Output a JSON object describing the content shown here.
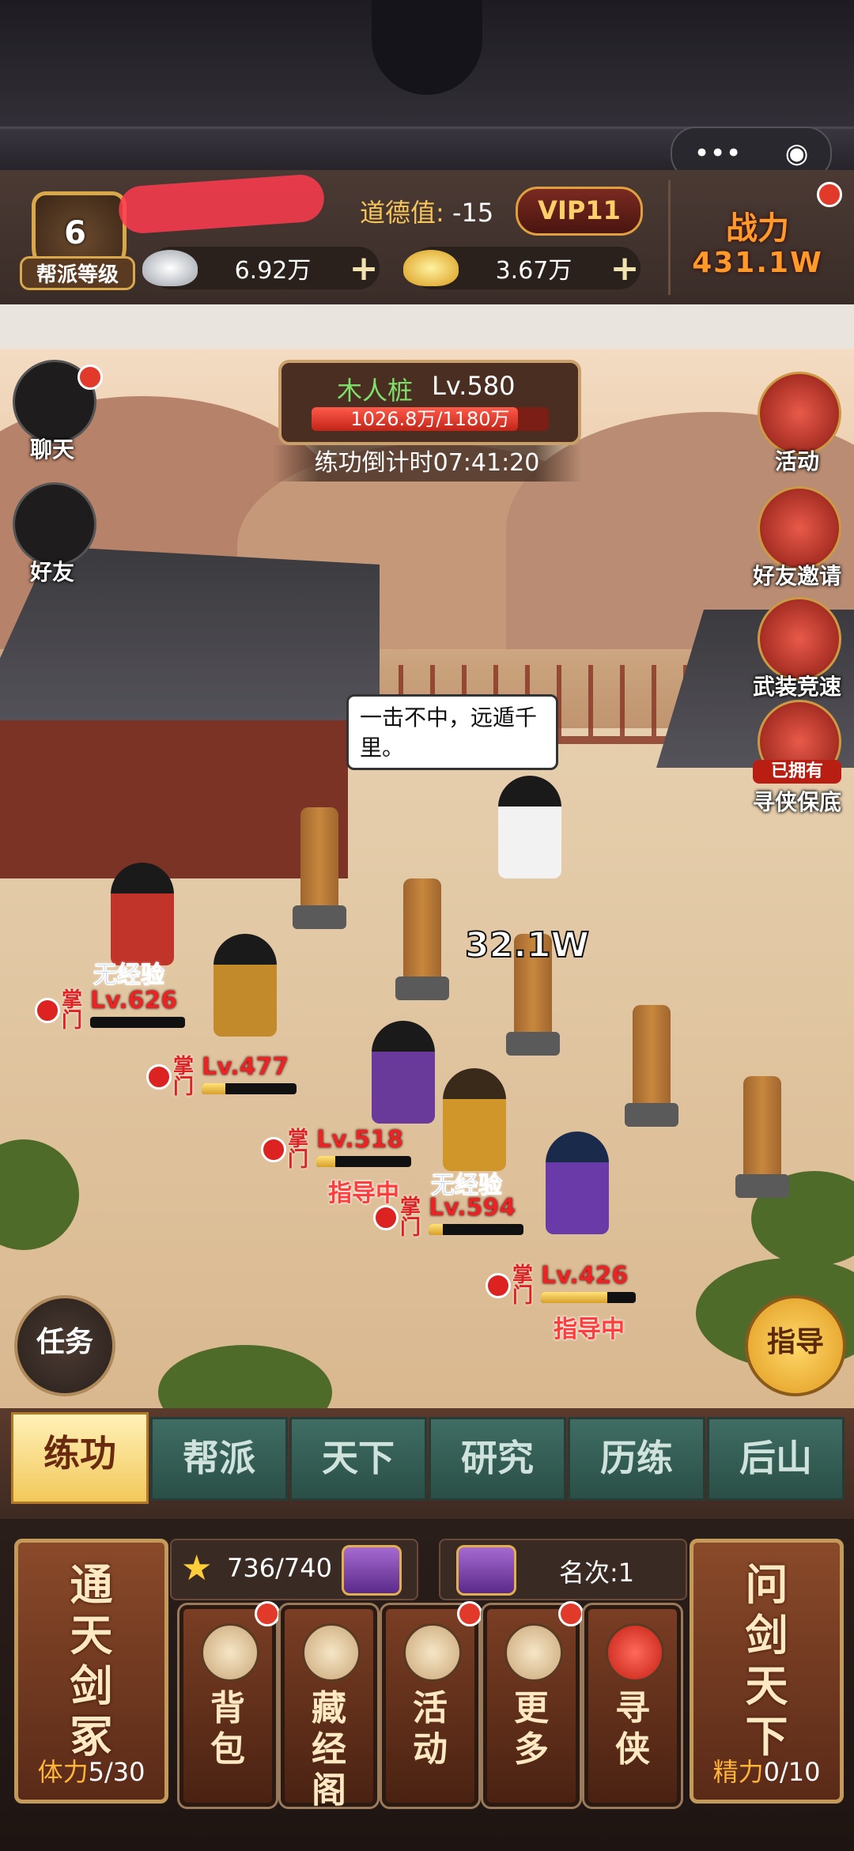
{
  "menu_capsule": {
    "more_icon": "•••",
    "close_icon": "◉"
  },
  "player": {
    "level": "6",
    "level_label": "帮派等级",
    "morality_label": "道德值:",
    "morality_value": "-15",
    "vip": "VIP11",
    "silver": "6.92万",
    "gold": "3.67万",
    "add_icon": "+",
    "power_label": "战力",
    "power_value": "431.1W"
  },
  "side_left": [
    {
      "label": "聊天",
      "icon": "chat-icon"
    },
    {
      "label": "好友",
      "icon": "fist-icon"
    }
  ],
  "side_right": [
    {
      "label": "活动",
      "icon": "drum-icon"
    },
    {
      "label": "好友邀请",
      "icon": "handshake-icon"
    },
    {
      "label": "武装竞速",
      "icon": "weapons-icon"
    },
    {
      "label": "寻侠保底",
      "badge": "已拥有",
      "icon": "hero-portrait-icon"
    }
  ],
  "dummy": {
    "name": "木人桩",
    "level": "Lv.580",
    "hp": "1026.8万/1180万",
    "hp_ratio": 0.87
  },
  "countdown": "练功倒计时07:41:20",
  "speech": "一击不中，远遁千里。",
  "damage": "32.1W",
  "disciples": [
    {
      "level": "Lv.626",
      "tag": "无经验",
      "role": "掌门",
      "bar": 0.0
    },
    {
      "level": "Lv.477",
      "role": "掌门",
      "bar": 0.25
    },
    {
      "level": "Lv.518",
      "role": "掌门",
      "guide": "指导中",
      "bar": 0.2
    },
    {
      "level": "Lv.594",
      "tag": "无经验",
      "role": "掌门",
      "bar": 0.15
    },
    {
      "level": "Lv.426",
      "role": "掌门",
      "guide": "指导中",
      "bar": 0.7
    }
  ],
  "buttons": {
    "task": "任务",
    "guide": "指导"
  },
  "tabs": [
    "练功",
    "帮派",
    "天下",
    "研究",
    "历练",
    "后山"
  ],
  "active_tab": "练功",
  "bottom": {
    "left_card": {
      "title": "通天剑冢",
      "stat_label": "体力",
      "stat_value": "5/30"
    },
    "right_card": {
      "title": "问剑天下",
      "stat_label": "精力",
      "stat_value": "0/10"
    },
    "stars": "736/740",
    "rank": "名次:1",
    "items": [
      {
        "label": "背包",
        "icon": "bag-icon",
        "dot": true
      },
      {
        "label": "藏经阁",
        "icon": "pavilion-icon",
        "dot": false
      },
      {
        "label": "活动",
        "icon": "lantern-icon",
        "dot": true
      },
      {
        "label": "更多",
        "icon": "flower-icon",
        "dot": true
      },
      {
        "label": "寻侠",
        "icon": "scroll-icon",
        "dot": false
      }
    ]
  }
}
